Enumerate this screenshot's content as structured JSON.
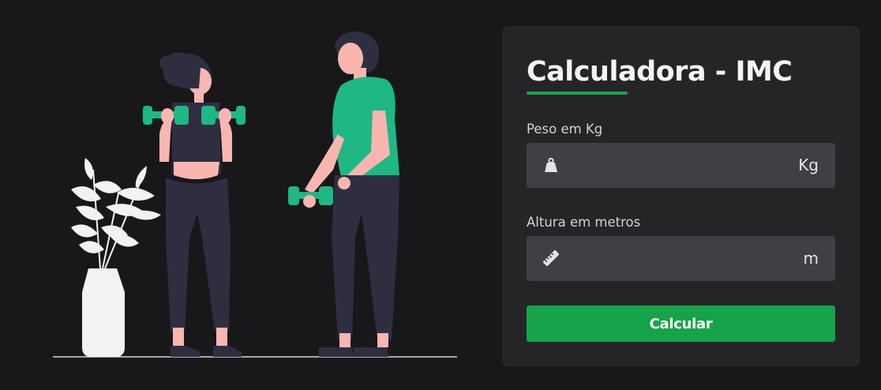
{
  "illustration": {
    "leaf_color": "#f2f2f2",
    "dumbbell_color": "#1fb783",
    "shirt_color": "#1fb783",
    "skin_color": "#f9b6b1",
    "clothes_color": "#2f2e41",
    "hair_color": "#2f2e41"
  },
  "form": {
    "title": "Calculadora - IMC",
    "accent_color": "#16a34a",
    "weight": {
      "label": "Peso em Kg",
      "value": "",
      "placeholder": "",
      "unit": "Kg",
      "icon": "weight-icon"
    },
    "height": {
      "label": "Altura em metros",
      "value": "",
      "placeholder": "",
      "unit": "m",
      "icon": "ruler-icon"
    },
    "submit_label": "Calcular"
  }
}
